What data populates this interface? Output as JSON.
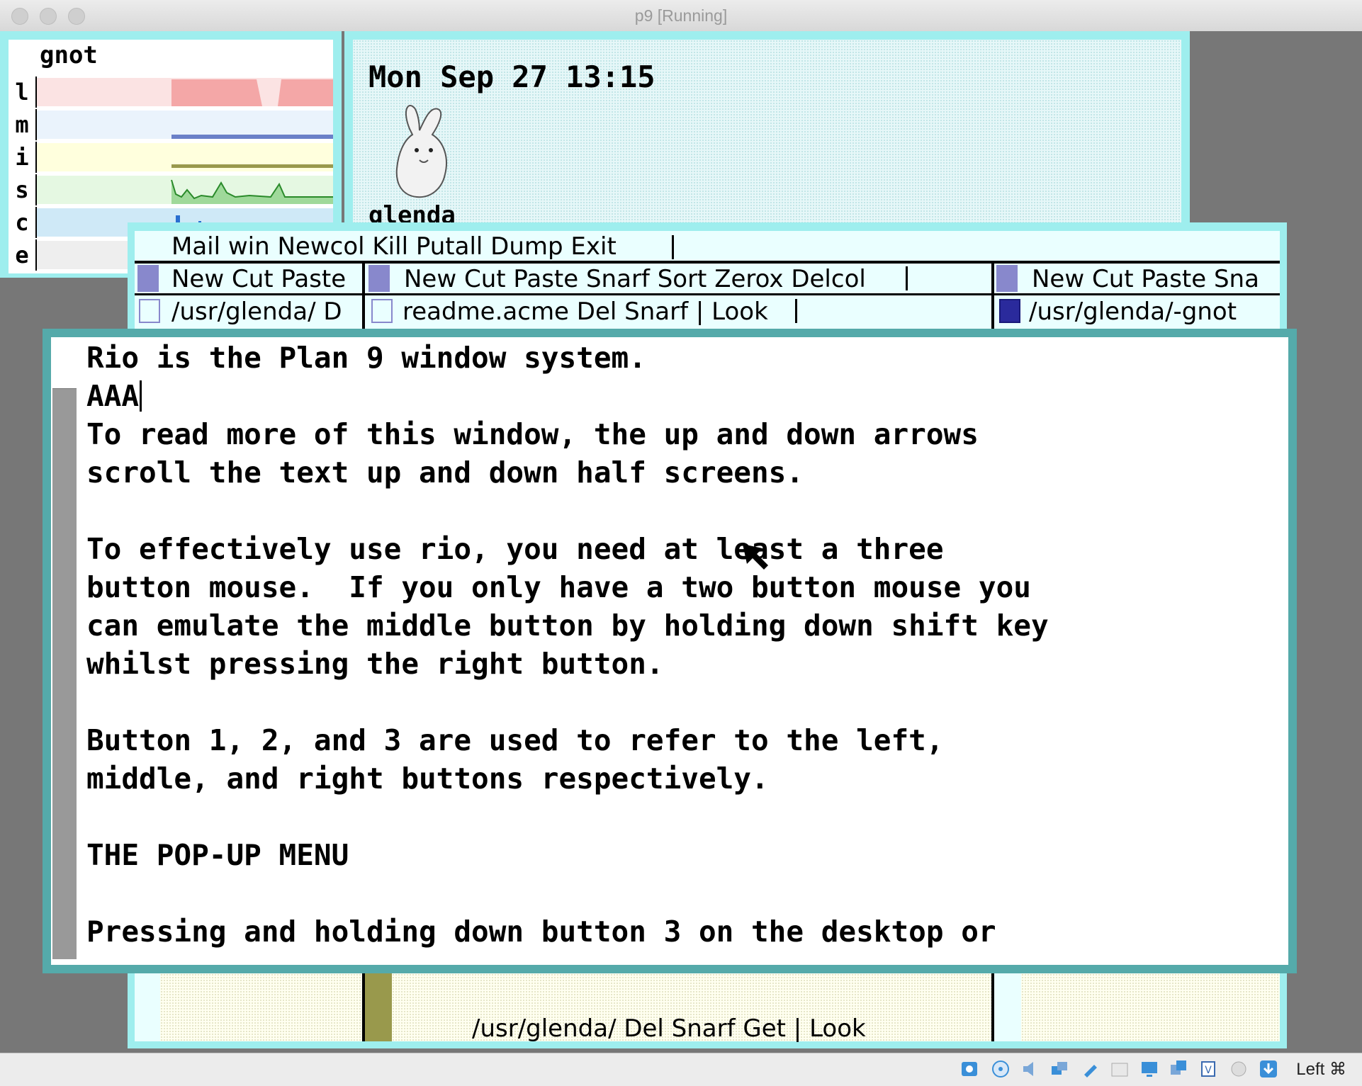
{
  "host_window": {
    "title": "p9 [Running]",
    "host_key": "Left ⌘"
  },
  "stats": {
    "hostname": "gnot",
    "rows": [
      {
        "label": "l",
        "metric": "load",
        "color": "#f4a7a7"
      },
      {
        "label": "m",
        "metric": "memory",
        "color": "#bcd6f4"
      },
      {
        "label": "i",
        "metric": "interrupts",
        "color": "#ffffcc"
      },
      {
        "label": "s",
        "metric": "syscalls",
        "color": "#c7f0c2"
      },
      {
        "label": "c",
        "metric": "context switches",
        "color": "#b9ddf2"
      },
      {
        "label": "e",
        "metric": "ether",
        "color": "#dddddd"
      }
    ]
  },
  "faces": {
    "date": "Mon Sep 27 13:15",
    "user": "glenda"
  },
  "acme": {
    "main_tag": "Mail win Newcol Kill Putall Dump Exit",
    "columns": [
      {
        "tag": "New Cut Paste",
        "window_tag": "/usr/glenda/ D"
      },
      {
        "tag": "New Cut Paste Snarf Sort Zerox Delcol",
        "window_tag": "readme.acme Del Snarf | Look",
        "bottom_tag": "/usr/glenda/ Del Snarf Get | Look"
      },
      {
        "tag": "New Cut Paste Sna",
        "window_tag": "/usr/glenda/-gnot"
      }
    ]
  },
  "rio_window": {
    "lines": [
      "Rio is the Plan 9 window system.",
      "AAA",
      "To read more of this window, the up and down arrows",
      "scroll the text up and down half screens.",
      "",
      "To effectively use rio, you need at least a three",
      "button mouse.  If you only have a two button mouse you",
      "can emulate the middle button by holding down shift key",
      "whilst pressing the right button.",
      "",
      "Button 1, 2, and 3 are used to refer to the left,",
      "middle, and right buttons respectively.",
      "",
      "THE POP-UP MENU",
      "",
      "Pressing and holding down button 3 on the desktop or"
    ]
  },
  "status_icons": [
    "hard-disk-icon",
    "optical-drive-icon",
    "audio-icon",
    "network-icon",
    "usb-icon",
    "shared-folder-icon",
    "display-icon",
    "snapshot-icon",
    "recording-icon",
    "mouse-integration-icon",
    "download-icon"
  ]
}
